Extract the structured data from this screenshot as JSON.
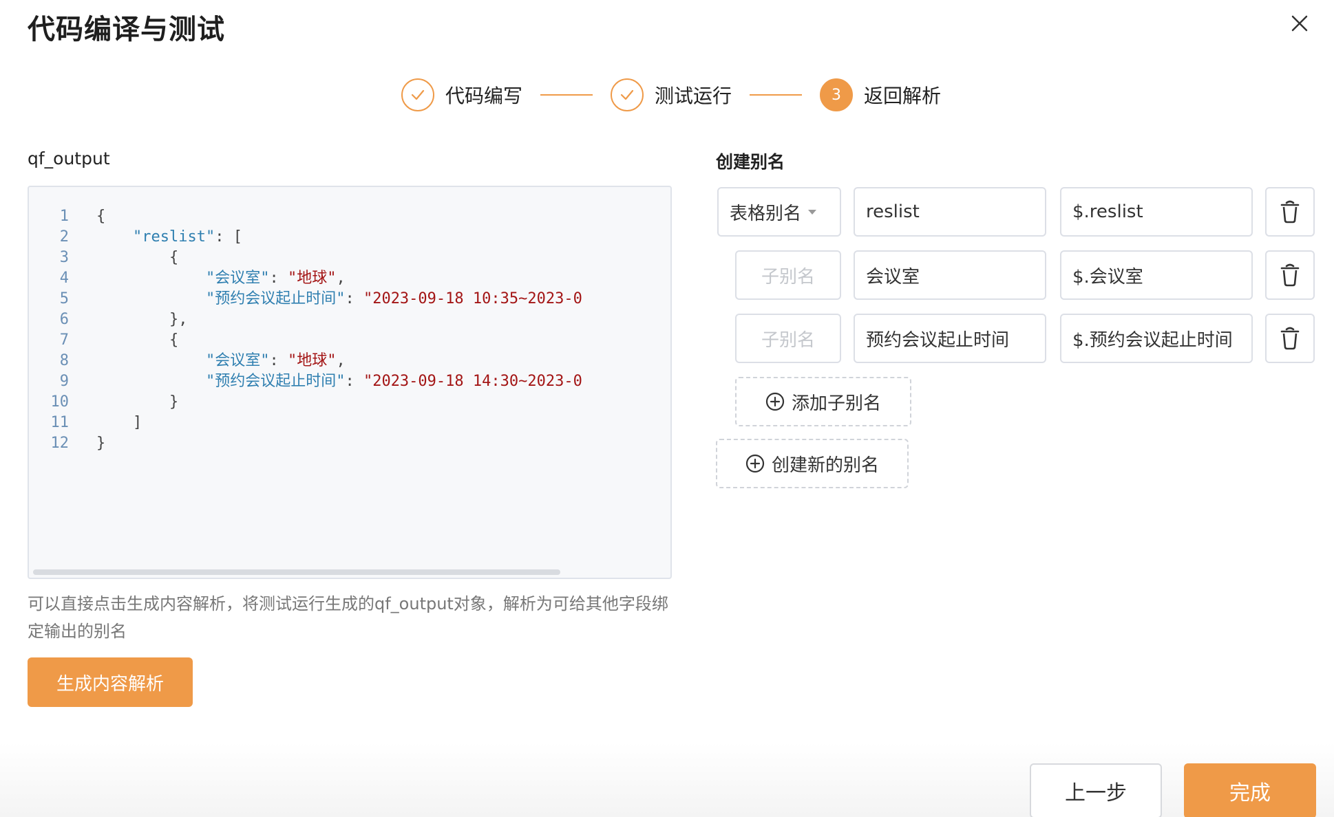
{
  "dialog": {
    "title": "代码编译与测试",
    "close_icon": "close-icon"
  },
  "steps": [
    {
      "label": "代码编写",
      "status": "done"
    },
    {
      "label": "测试运行",
      "status": "done"
    },
    {
      "label": "返回解析",
      "status": "active",
      "number": "3"
    }
  ],
  "left": {
    "label": "qf_output",
    "code_lines": [
      {
        "n": "1",
        "indent": "",
        "parts": [
          [
            "punc",
            "{"
          ]
        ]
      },
      {
        "n": "2",
        "indent": "    ",
        "parts": [
          [
            "key",
            "\"reslist\""
          ],
          [
            "punc",
            ": ["
          ]
        ]
      },
      {
        "n": "3",
        "indent": "        ",
        "parts": [
          [
            "punc",
            "{"
          ]
        ]
      },
      {
        "n": "4",
        "indent": "            ",
        "parts": [
          [
            "key",
            "\"会议室\""
          ],
          [
            "punc",
            ": "
          ],
          [
            "str",
            "\"地球\""
          ],
          [
            "punc",
            ","
          ]
        ]
      },
      {
        "n": "5",
        "indent": "            ",
        "parts": [
          [
            "key",
            "\"预约会议起止时间\""
          ],
          [
            "punc",
            ": "
          ],
          [
            "str",
            "\"2023-09-18 10:35~2023-0"
          ]
        ]
      },
      {
        "n": "6",
        "indent": "        ",
        "parts": [
          [
            "punc",
            "},"
          ]
        ]
      },
      {
        "n": "7",
        "indent": "        ",
        "parts": [
          [
            "punc",
            "{"
          ]
        ]
      },
      {
        "n": "8",
        "indent": "            ",
        "parts": [
          [
            "key",
            "\"会议室\""
          ],
          [
            "punc",
            ": "
          ],
          [
            "str",
            "\"地球\""
          ],
          [
            "punc",
            ","
          ]
        ]
      },
      {
        "n": "9",
        "indent": "            ",
        "parts": [
          [
            "key",
            "\"预约会议起止时间\""
          ],
          [
            "punc",
            ": "
          ],
          [
            "str",
            "\"2023-09-18 14:30~2023-0"
          ]
        ]
      },
      {
        "n": "10",
        "indent": "        ",
        "parts": [
          [
            "punc",
            "}"
          ]
        ]
      },
      {
        "n": "11",
        "indent": "    ",
        "parts": [
          [
            "punc",
            "]"
          ]
        ]
      },
      {
        "n": "12",
        "indent": "",
        "parts": [
          [
            "punc",
            "}"
          ]
        ]
      }
    ],
    "hint": "可以直接点击生成内容解析，将测试运行生成的qf_output对象，解析为可给其他字段绑定输出的别名",
    "generate_button": "生成内容解析"
  },
  "right": {
    "label": "创建别名",
    "rows": [
      {
        "type_label": "表格别名",
        "name": "reslist",
        "path": "$.reslist"
      },
      {
        "type_label": "子别名",
        "name": "会议室",
        "path": "$.会议室"
      },
      {
        "type_label": "子别名",
        "name": "预约会议起止时间",
        "path": "$.预约会议起止时间"
      }
    ],
    "add_child_button": "添加子别名",
    "create_new_button": "创建新的别名"
  },
  "footer": {
    "prev_button": "上一步",
    "done_button": "完成"
  },
  "colors": {
    "accent": "#ef9a48"
  }
}
